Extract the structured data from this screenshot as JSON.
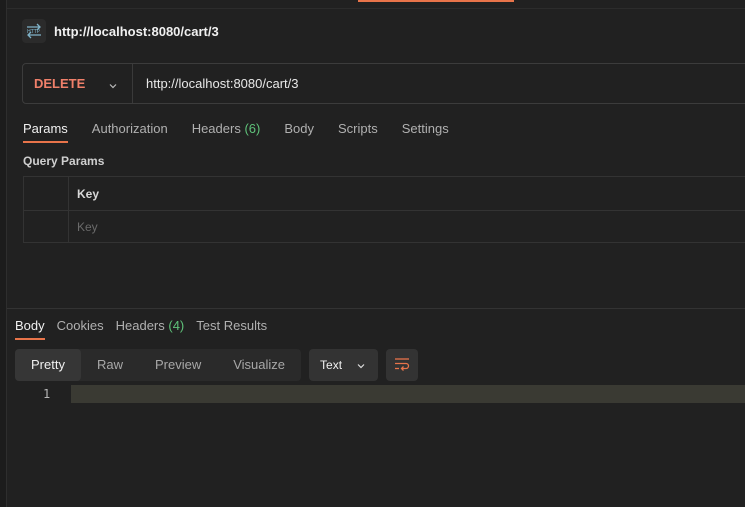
{
  "request": {
    "title": "http://localhost:8080/cart/3",
    "method": "DELETE",
    "url": "http://localhost:8080/cart/3"
  },
  "request_tabs": [
    {
      "label": "Params",
      "count": ""
    },
    {
      "label": "Authorization",
      "count": ""
    },
    {
      "label": "Headers",
      "count": "(6)"
    },
    {
      "label": "Body",
      "count": ""
    },
    {
      "label": "Scripts",
      "count": ""
    },
    {
      "label": "Settings",
      "count": ""
    }
  ],
  "query_params": {
    "section_label": "Query Params",
    "key_header": "Key",
    "key_placeholder": "Key"
  },
  "response_tabs": [
    {
      "label": "Body",
      "count": ""
    },
    {
      "label": "Cookies",
      "count": ""
    },
    {
      "label": "Headers",
      "count": "(4)"
    },
    {
      "label": "Test Results",
      "count": ""
    }
  ],
  "response_toolbar": {
    "view_modes": [
      "Pretty",
      "Raw",
      "Preview",
      "Visualize"
    ],
    "format": "Text"
  },
  "editor": {
    "line_number": "1"
  },
  "colors": {
    "accent": "#e8744a",
    "method_delete": "#f0806a",
    "count_green": "#5fc27a",
    "background": "#212121"
  },
  "icons": [
    "http-icon",
    "chevron-down-icon",
    "wrap-lines-icon"
  ]
}
